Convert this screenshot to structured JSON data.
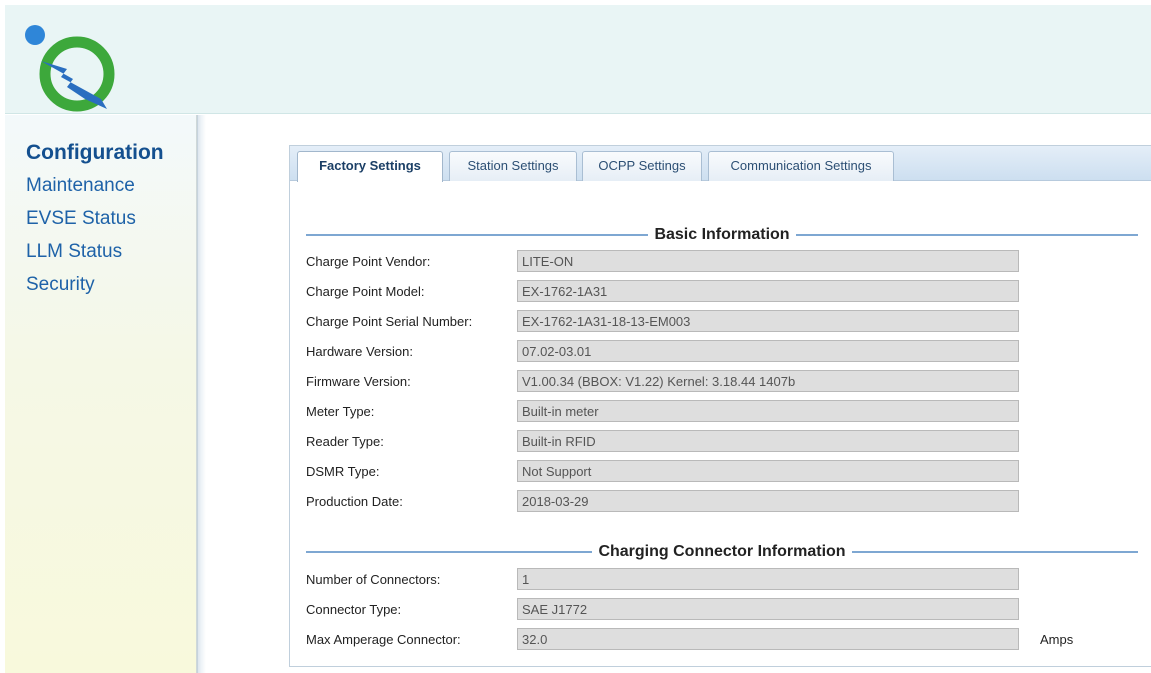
{
  "sidebar": {
    "items": [
      {
        "label": "Configuration"
      },
      {
        "label": "Maintenance"
      },
      {
        "label": "EVSE Status"
      },
      {
        "label": "LLM Status"
      },
      {
        "label": "Security"
      }
    ]
  },
  "tabs": [
    {
      "label": "Factory Settings"
    },
    {
      "label": "Station Settings"
    },
    {
      "label": "OCPP Settings"
    },
    {
      "label": "Communication Settings"
    }
  ],
  "basic_info": {
    "title": "Basic Information",
    "fields": [
      {
        "label": "Charge Point Vendor:",
        "value": "LITE-ON"
      },
      {
        "label": "Charge Point Model:",
        "value": "EX-1762-1A31"
      },
      {
        "label": "Charge Point Serial Number:",
        "value": "EX-1762-1A31-18-13-EM003"
      },
      {
        "label": "Hardware Version:",
        "value": "07.02-03.01"
      },
      {
        "label": "Firmware Version:",
        "value": "V1.00.34 (BBOX: V1.22) Kernel: 3.18.44 1407b"
      },
      {
        "label": "Meter Type:",
        "value": "Built-in meter"
      },
      {
        "label": "Reader Type:",
        "value": "Built-in RFID"
      },
      {
        "label": "DSMR Type:",
        "value": "Not Support"
      },
      {
        "label": "Production Date:",
        "value": "2018-03-29"
      }
    ]
  },
  "connector_info": {
    "title": "Charging Connector Information",
    "fields": [
      {
        "label": "Number of Connectors:",
        "value": "1"
      },
      {
        "label": "Connector Type:",
        "value": "SAE J1772"
      },
      {
        "label": "Max Amperage Connector:",
        "value": "32.0",
        "unit": "Amps"
      }
    ]
  }
}
